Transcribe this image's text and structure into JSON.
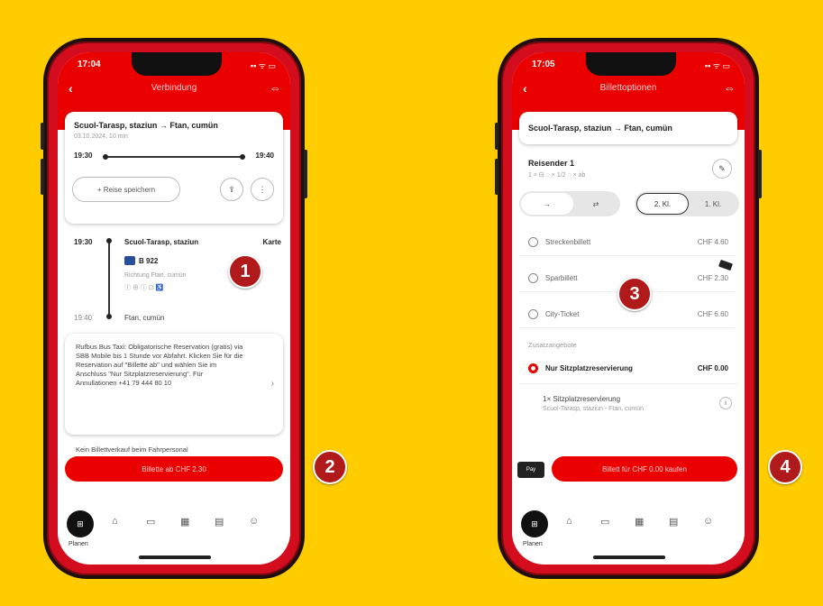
{
  "badges": [
    "1",
    "2",
    "3",
    "4"
  ],
  "left_phone": {
    "status_time": "17:04",
    "status_icons": "▪▪ ᯤ ▭",
    "nav_title": "Verbindung",
    "route": "Scuol-Tarasp, staziun → Ftan, cumün",
    "date_line": "03.10.2024, 10 min",
    "dep_time": "19:30",
    "arr_time": "19:40",
    "save_trip": "Reise speichern",
    "share_icon": "⇪",
    "more_icon": "⋮",
    "stop1_time": "19:30",
    "stop1_name": "Scuol-Tarasp, staziun",
    "map_label": "Karte",
    "bus_line": "B 922",
    "direction": "Richtung Ftan, cumün",
    "vehicle_info": "Ⓘ ⊕ ⓘ ⊡ ♿",
    "stop2_time": "19:40",
    "stop2_name": "Ftan, cumün",
    "info_text": "Rufbus Bus Taxi: Obligatorische Reservation (gratis) via SBB Mobile bis 1 Stunde vor Abfahrt. Klicken Sie für die Reservation auf \"Billette ab\" und wählen Sie im Anschluss \"Nur Sitzplatzreservierung\". Für Annullationen +41 79 444 80 10",
    "info_text_2": "Kein Billettverkauf beim Fahrpersonal",
    "cta": "Billette ab CHF 2.30",
    "tab_label": "Planen"
  },
  "right_phone": {
    "status_time": "17:05",
    "status_icons": "▪▪ ᯤ ▭",
    "nav_title": "Billettoptionen",
    "route": "Scuol-Tarasp, staziun → Ftan, cumün",
    "traveller_label": "Reisender 1",
    "traveller_sub": "1 × ⊟   ◌ × 1/2   ◌ × ab",
    "seg_one_way": "→",
    "seg_return": "⇄",
    "class2": "2. Kl.",
    "class1": "1. Kl.",
    "options": [
      {
        "name": "Streckenbillett",
        "price": "CHF 4.60"
      },
      {
        "name": "Sparbillett",
        "price": "CHF 2.30"
      },
      {
        "name": "City-Ticket",
        "price": "CHF 6.60"
      }
    ],
    "extras_header": "Zusatzangebote",
    "reservation_label": "Nur Sitzplatzreservierung",
    "reservation_price": "CHF 0.00",
    "reservation_detail": "1× Sitzplatzreservierung",
    "reservation_route": "Scuol-Tarasp, staziun - Ftan, cumün",
    "cta": "Billett für CHF 0.00 kaufen",
    "pay_label": "Pay",
    "tab_label": "Planen"
  },
  "colors": {
    "background": "#ffcc00",
    "sbb_red": "#eb0000",
    "badge": "#b01a1a"
  }
}
